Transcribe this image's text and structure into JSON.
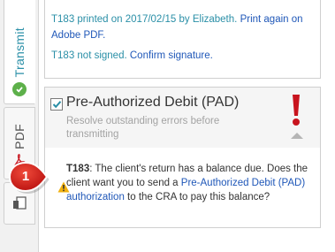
{
  "sidebar": {
    "tabs": [
      {
        "label": "Transmit",
        "icon": "check-circle-icon",
        "active": true
      },
      {
        "label": "PDF",
        "icon": "pdf-icon",
        "active": false
      },
      {
        "label": "",
        "icon": "document-icon",
        "active": false
      }
    ]
  },
  "transmit_status": {
    "printed_prefix": "T183 printed on 2017/02/15 by Elizabeth.",
    "print_again_link": "Print again on Adobe PDF.",
    "not_signed_prefix": "T183 not signed.",
    "confirm_link": "Confirm signature."
  },
  "pad_card": {
    "title": "Pre-Authorized Debit (PAD)",
    "subtitle": "Resolve outstanding errors before transmitting",
    "checked": true,
    "status_icon": "exclamation-icon",
    "collapse_icon": "chevron-up-icon",
    "message": {
      "form": "T183",
      "text_1": ": The client's return has a balance due. Does the client want you to send a ",
      "link": "Pre-Authorized Debit (PAD) authorization",
      "text_2": " to the CRA to pay this balance?"
    }
  },
  "callout": {
    "number": "1"
  },
  "colors": {
    "accent": "#2a8fa7",
    "link": "#1f57b8",
    "error": "#c8141e",
    "success": "#5db04a",
    "warning": "#f2b10f"
  }
}
